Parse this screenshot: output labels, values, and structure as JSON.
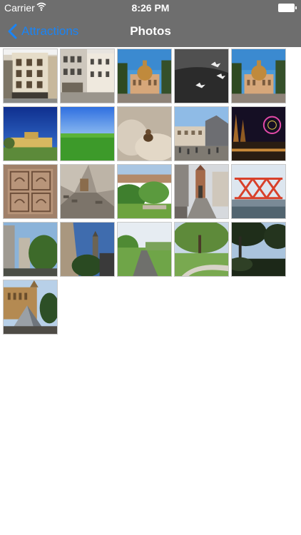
{
  "status_bar": {
    "carrier": "Carrier",
    "time": "8:26 PM"
  },
  "nav": {
    "back_label": "Attractions",
    "title": "Photos"
  },
  "photos": [
    "building-facade",
    "old-town-street",
    "domed-building",
    "birds-over-water",
    "domed-building",
    "palace-blue-sky",
    "green-meadow",
    "stone-sculpture",
    "town-square",
    "ferris-wheel-night",
    "carved-relief",
    "aerial-rooftops",
    "garden-park",
    "street-tower-gate",
    "bridge-construction",
    "tower-trees",
    "church-tower",
    "country-road",
    "riverside-path",
    "tree-silhouette",
    "cathedral-pyramid"
  ],
  "colors": {
    "bar": "#6e6e6e",
    "accent": "#1a84f5"
  }
}
